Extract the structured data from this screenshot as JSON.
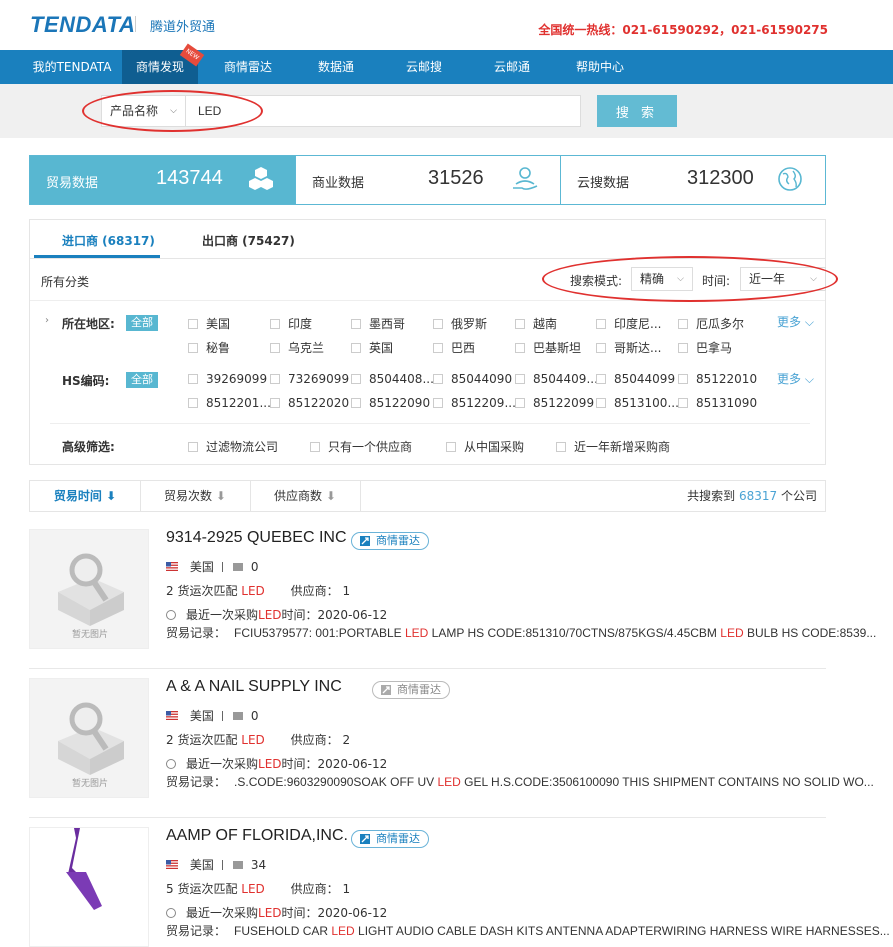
{
  "header": {
    "logo_text": "TENDATA",
    "brand_cn": "腾道外贸通",
    "hotline": "全国统一热线：021-61590292，021-61590275"
  },
  "nav": {
    "items": [
      {
        "label": "我的TENDATA"
      },
      {
        "label": "商情发现",
        "active": true,
        "badge": "NEW"
      },
      {
        "label": "商情雷达"
      },
      {
        "label": "数据通"
      },
      {
        "label": "云邮搜"
      },
      {
        "label": "云邮通"
      },
      {
        "label": "帮助中心"
      }
    ]
  },
  "search": {
    "field_type": "产品名称",
    "query": "LED",
    "button_label": "搜 索"
  },
  "stats": [
    {
      "label": "贸易数据",
      "value": "143744",
      "icon": "cubes-icon",
      "active": true
    },
    {
      "label": "商业数据",
      "value": "31526",
      "icon": "person-hand-icon"
    },
    {
      "label": "云搜数据",
      "value": "312300",
      "icon": "globe-icon"
    }
  ],
  "tabs": [
    {
      "label": "进口商 (68317)",
      "active": true
    },
    {
      "label": "出口商 (75427)"
    }
  ],
  "filters": {
    "all_categories": "所有分类",
    "search_mode_label": "搜索模式:",
    "search_mode_value": "精确",
    "time_label": "时间:",
    "time_value": "近一年",
    "region_label": "所在地区:",
    "region_all": "全部",
    "regions": [
      "美国",
      "印度",
      "墨西哥",
      "俄罗斯",
      "越南",
      "印度尼...",
      "厄瓜多尔",
      "秘鲁",
      "乌克兰",
      "英国",
      "巴西",
      "巴基斯坦",
      "哥斯达...",
      "巴拿马"
    ],
    "hs_label": "HS编码:",
    "hs_all": "全部",
    "hs_codes": [
      "39269099",
      "73269099",
      "8504408...",
      "85044090",
      "8504409...",
      "85044099",
      "85122010",
      "8512201...",
      "85122020",
      "85122090",
      "8512209...",
      "85122099",
      "8513100...",
      "85131090"
    ],
    "more_label": "更多",
    "advanced_label": "高级筛选:",
    "advanced_options": [
      "过滤物流公司",
      "只有一个供应商",
      "从中国采购",
      "近一年新增采购商"
    ]
  },
  "sort": {
    "items": [
      {
        "label": "贸易时间",
        "active": true
      },
      {
        "label": "贸易次数"
      },
      {
        "label": "供应商数"
      }
    ],
    "result_prefix": "共搜索到",
    "result_count": "68317",
    "result_suffix": "个公司"
  },
  "colors": {
    "nav_bg": "#1a80be",
    "accent": "#58b7d1",
    "highlight_red": "#e0312f"
  },
  "companies": [
    {
      "name": "9314-2925 QUEBEC INC",
      "radar_label": "商情雷达",
      "radar_active": true,
      "country": "美国",
      "email_count": "0",
      "shipments_prefix": "2 货运次匹配",
      "keyword": "LED",
      "supplier_label": "供应商：",
      "supplier_count": "1",
      "last_purchase_prefix": "最近一次采购",
      "last_purchase_suffix": "时间：2020-06-12",
      "record_label": "贸易记录：",
      "record_parts": [
        "FCIU5379577: 001:PORTABLE ",
        "LED",
        " LAMP HS CODE:851310/70CTNS/875KGS/4.45CBM ",
        "LED",
        " BULB HS CODE:8539..."
      ],
      "thumb_caption": "暂无图片",
      "thumb_type": "placeholder"
    },
    {
      "name": "A & A NAIL SUPPLY INC",
      "radar_label": "商情雷达",
      "radar_active": false,
      "country": "美国",
      "email_count": "0",
      "shipments_prefix": "2 货运次匹配",
      "keyword": "LED",
      "supplier_label": "供应商：",
      "supplier_count": "2",
      "last_purchase_prefix": "最近一次采购",
      "last_purchase_suffix": "时间：2020-06-12",
      "record_label": "贸易记录：",
      "record_parts": [
        ".S.CODE:9603290090SOAK OFF UV ",
        "LED",
        " GEL H.S.CODE:3506100090 THIS SHIPMENT CONTAINS NO SOLID WO...",
        "",
        ""
      ],
      "thumb_caption": "暂无图片",
      "thumb_type": "placeholder"
    },
    {
      "name": "AAMP OF FLORIDA,INC.",
      "radar_label": "商情雷达",
      "radar_active": true,
      "country": "美国",
      "email_count": "34",
      "shipments_prefix": "5 货运次匹配",
      "keyword": "LED",
      "supplier_label": "供应商：",
      "supplier_count": "1",
      "last_purchase_prefix": "最近一次采购",
      "last_purchase_suffix": "时间：2020-06-12",
      "record_label": "贸易记录：",
      "record_parts": [
        "FUSEHOLD CAR ",
        "LED",
        " LIGHT AUDIO CABLE DASH KITS ANTENNA ADAPTERWIRING HARNESS WIRE HARNESSES...",
        "",
        ""
      ],
      "thumb_caption": "",
      "thumb_type": "logo"
    }
  ]
}
